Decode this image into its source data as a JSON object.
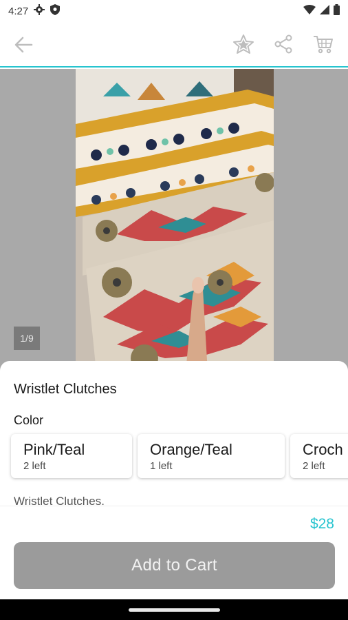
{
  "status_bar": {
    "time": "4:27",
    "icons": [
      "gear-icon",
      "shield-icon",
      "wifi-icon",
      "signal-icon",
      "battery-icon"
    ]
  },
  "app_bar": {
    "icons": [
      "back-arrow-icon",
      "star-icon",
      "share-icon",
      "cart-icon"
    ]
  },
  "gallery": {
    "counter": "1/9"
  },
  "product": {
    "title": "Wristlet Clutches",
    "color_label": "Color",
    "options": [
      {
        "name": "Pink/Teal",
        "stock": "2 left"
      },
      {
        "name": "Orange/Teal",
        "stock": "1 left"
      },
      {
        "name": "Croch",
        "stock": "2 left"
      }
    ],
    "description": "Wristlet Clutches."
  },
  "footer": {
    "price": "$28",
    "add_to_cart_label": "Add to Cart"
  },
  "colors": {
    "accent": "#27c4cf",
    "button_disabled": "#9b9b9b"
  }
}
